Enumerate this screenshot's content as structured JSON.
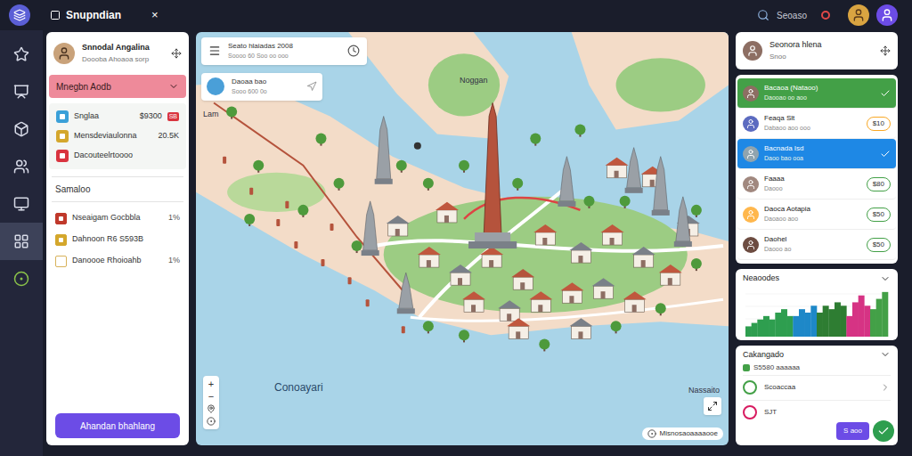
{
  "window": {
    "title": "Snupndian",
    "close": "×"
  },
  "topbar": {
    "status": "Seoaso"
  },
  "rail": [
    {
      "selected": false
    },
    {
      "selected": false
    },
    {
      "selected": false
    },
    {
      "selected": false
    },
    {
      "selected": false
    },
    {
      "selected": true
    },
    {
      "selected": false
    }
  ],
  "left_panel": {
    "profile": {
      "name": "Snnodal Angalina",
      "subtitle": "Doooba Ahoaoa sorp"
    },
    "filter": {
      "label": "Mnegbn Aodb"
    },
    "stats": [
      {
        "label": "Snglaa",
        "value": "$9300",
        "badge": "SB",
        "color": "#3aa0d8"
      },
      {
        "label": "Mensdeviaulonna",
        "value": "20.5K",
        "badge": "",
        "color": "#d4a72c"
      },
      {
        "label": "Dacouteelrtoooo",
        "value": "",
        "badge": "",
        "color": "#d9343f"
      }
    ],
    "section": {
      "title": "Samaloo",
      "items": [
        {
          "label": "Nseaigam Gocbbla",
          "value": "1%",
          "color": "#c0392b"
        },
        {
          "label": "Dahnoon R6 S593B",
          "value": "",
          "color": "#d4a72c"
        },
        {
          "label": "Danoooe Rhoioahb",
          "value": "1%",
          "color": "#d8b25a"
        }
      ]
    },
    "button": "Ahandan bhahlang"
  },
  "map": {
    "search": {
      "title": "Seato hlaiadas 2008",
      "subtitle": "Soooo 60 Soo oo ooo"
    },
    "info": {
      "title": "Daoaa bao",
      "subtitle": "Sooo 600 0o"
    },
    "labels": [
      "Noggan",
      "Lam",
      "Conoayari",
      "Nassaito"
    ],
    "attribution": "Misnosaoaaaaooe",
    "zoom": [
      "+",
      "−"
    ]
  },
  "right_panel": {
    "profile": {
      "name": "Seonora hlena",
      "subtitle": "Snoo"
    },
    "items": [
      {
        "name": "Bacaoa (Nataoo)",
        "detail": "Daooao oo aoo",
        "badge": "",
        "selected": true,
        "color": "#43a047"
      },
      {
        "name": "Feaqa Slt",
        "detail": "Dabaoo aoo ooo",
        "badge": "$10",
        "selected": false,
        "color": "#f9a825"
      },
      {
        "name": "Bacnada Isd",
        "detail": "Daoo bao ooa",
        "badge": "",
        "selected": true,
        "color": "#1e88e5"
      },
      {
        "name": "Faaaa",
        "detail": "Daooo",
        "badge": "$80",
        "selected": false,
        "color": "#43a047"
      },
      {
        "name": "Daoca Aotapia",
        "detail": "Daoaoo aoo",
        "badge": "$50",
        "selected": false,
        "color": "#43a047"
      },
      {
        "name": "Daohel",
        "detail": "Daooo ao",
        "badge": "$50",
        "selected": false,
        "color": "#43a047"
      }
    ],
    "chart": {
      "title": "Neaoodes",
      "max": 14,
      "series": [
        {
          "color": "#2e9e4f",
          "values": [
            3,
            4,
            5,
            6,
            5,
            7,
            8,
            6
          ]
        },
        {
          "color": "#1e88c8",
          "values": [
            6,
            8,
            7,
            9
          ]
        },
        {
          "color": "#2e7d32",
          "values": [
            7,
            9,
            8,
            10,
            9
          ]
        },
        {
          "color": "#d63384",
          "values": [
            6,
            10,
            12,
            9
          ]
        },
        {
          "color": "#43a047",
          "values": [
            8,
            11,
            13
          ]
        }
      ]
    },
    "card": {
      "title": "Cakangado",
      "amount": "S5580 aaaaaa",
      "rows": [
        {
          "label": "Scoaccaa",
          "color": "#43a047"
        },
        {
          "label": "SJT",
          "color": "#d81b60"
        }
      ],
      "action": "S aoo"
    }
  }
}
